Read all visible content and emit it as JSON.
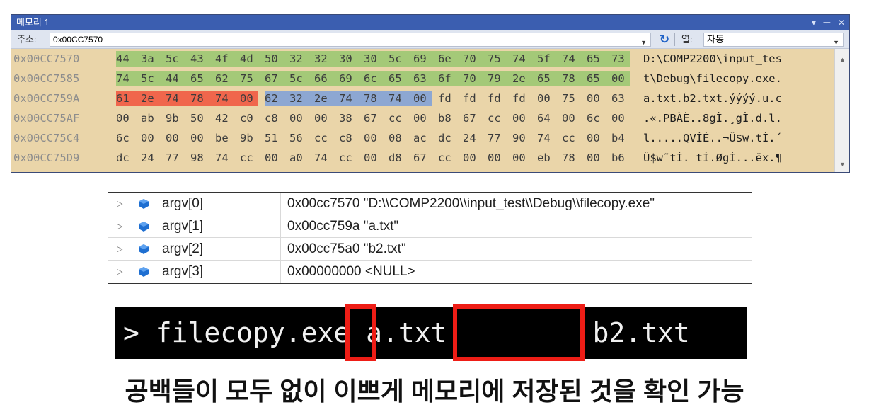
{
  "memory_window": {
    "title": "메모리 1",
    "title_controls": [
      "▾",
      "ᅮ",
      "✕"
    ],
    "address_label": "주소:",
    "address_value": "0x00CC7570",
    "columns_label": "열:",
    "columns_value": "자동",
    "rows": [
      {
        "address": "0x00CC7570",
        "bytes": [
          "44",
          "3a",
          "5c",
          "43",
          "4f",
          "4d",
          "50",
          "32",
          "32",
          "30",
          "30",
          "5c",
          "69",
          "6e",
          "70",
          "75",
          "74",
          "5f",
          "74",
          "65",
          "73"
        ],
        "highlight": [
          "green",
          "green",
          "green",
          "green",
          "green",
          "green",
          "green",
          "green",
          "green",
          "green",
          "green",
          "green",
          "green",
          "green",
          "green",
          "green",
          "green",
          "green",
          "green",
          "green",
          "green"
        ],
        "ascii": "D:\\COMP2200\\input_tes"
      },
      {
        "address": "0x00CC7585",
        "bytes": [
          "74",
          "5c",
          "44",
          "65",
          "62",
          "75",
          "67",
          "5c",
          "66",
          "69",
          "6c",
          "65",
          "63",
          "6f",
          "70",
          "79",
          "2e",
          "65",
          "78",
          "65",
          "00"
        ],
        "highlight": [
          "green",
          "green",
          "green",
          "green",
          "green",
          "green",
          "green",
          "green",
          "green",
          "green",
          "green",
          "green",
          "green",
          "green",
          "green",
          "green",
          "green",
          "green",
          "green",
          "green",
          "green"
        ],
        "ascii": "t\\Debug\\filecopy.exe."
      },
      {
        "address": "0x00CC759A",
        "bytes": [
          "61",
          "2e",
          "74",
          "78",
          "74",
          "00",
          "62",
          "32",
          "2e",
          "74",
          "78",
          "74",
          "00",
          "fd",
          "fd",
          "fd",
          "fd",
          "00",
          "75",
          "00",
          "63"
        ],
        "highlight": [
          "red",
          "red",
          "red",
          "red",
          "red",
          "red",
          "blue",
          "blue",
          "blue",
          "blue",
          "blue",
          "blue",
          "blue",
          "",
          "",
          "",
          "",
          "",
          "",
          "",
          ""
        ],
        "ascii": "a.txt.b2.txt.ýýýý.u.c"
      },
      {
        "address": "0x00CC75AF",
        "bytes": [
          "00",
          "ab",
          "9b",
          "50",
          "42",
          "c0",
          "c8",
          "00",
          "00",
          "38",
          "67",
          "cc",
          "00",
          "b8",
          "67",
          "cc",
          "00",
          "64",
          "00",
          "6c",
          "00"
        ],
        "highlight": [
          "",
          "",
          "",
          "",
          "",
          "",
          "",
          "",
          "",
          "",
          "",
          "",
          "",
          "",
          "",
          "",
          "",
          "",
          "",
          "",
          ""
        ],
        "ascii": ".«.PBÀÈ..8gÌ.¸gÌ.d.l."
      },
      {
        "address": "0x00CC75C4",
        "bytes": [
          "6c",
          "00",
          "00",
          "00",
          "be",
          "9b",
          "51",
          "56",
          "cc",
          "c8",
          "00",
          "08",
          "ac",
          "dc",
          "24",
          "77",
          "90",
          "74",
          "cc",
          "00",
          "b4"
        ],
        "highlight": [
          "",
          "",
          "",
          "",
          "",
          "",
          "",
          "",
          "",
          "",
          "",
          "",
          "",
          "",
          "",
          "",
          "",
          "",
          "",
          "",
          ""
        ],
        "ascii": "l.....QVÌÈ..¬Ü$w.tÌ.´"
      },
      {
        "address": "0x00CC75D9",
        "bytes": [
          "dc",
          "24",
          "77",
          "98",
          "74",
          "cc",
          "00",
          "a0",
          "74",
          "cc",
          "00",
          "d8",
          "67",
          "cc",
          "00",
          "00",
          "00",
          "eb",
          "78",
          "00",
          "b6"
        ],
        "highlight": [
          "",
          "",
          "",
          "",
          "",
          "",
          "",
          "",
          "",
          "",
          "",
          "",
          "",
          "",
          "",
          "",
          "",
          "",
          "",
          "",
          ""
        ],
        "ascii": "Ü$w˜tÌ. tÌ.ØgÌ...ëx.¶"
      }
    ],
    "colors": {
      "green": "#a4c978",
      "red": "#f0664c",
      "blue": "#8da7d2"
    }
  },
  "argv_watch": [
    {
      "name": "argv[0]",
      "value": "0x00cc7570 \"D:\\\\COMP2200\\\\input_test\\\\Debug\\\\filecopy.exe\""
    },
    {
      "name": "argv[1]",
      "value": "0x00cc759a \"a.txt\""
    },
    {
      "name": "argv[2]",
      "value": "0x00cc75a0 \"b2.txt\""
    },
    {
      "name": "argv[3]",
      "value": "0x00000000 <NULL>"
    }
  ],
  "terminal": {
    "command": "> filecopy.exe a.txt         b2.txt"
  },
  "caption": "공백들이 모두 없이 이쁘게 메모리에 저장된 것을 확인 가능"
}
